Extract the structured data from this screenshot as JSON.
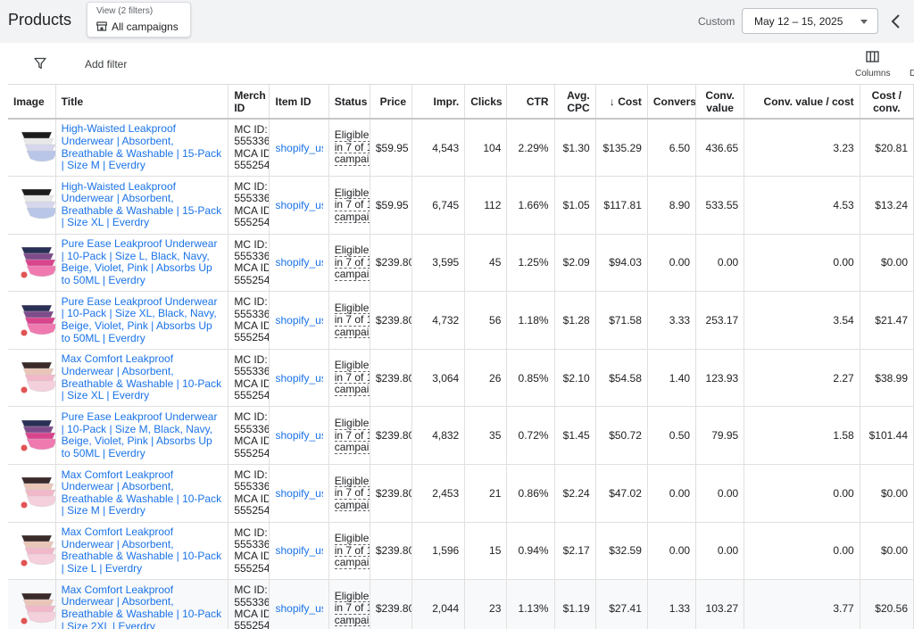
{
  "header": {
    "title": "Products",
    "view_label": "View (2 filters)",
    "view_value": "All campaigns",
    "custom_label": "Custom",
    "date_range": "May 12 – 15, 2025"
  },
  "toolbar": {
    "add_filter": "Add filter",
    "columns_label": "Columns",
    "truncated_label": "D"
  },
  "columns": {
    "image": "Image",
    "title": "Title",
    "merch_id": "Merch ID",
    "item_id": "Item ID",
    "status": "Status",
    "price": "Price",
    "impr": "Impr.",
    "clicks": "Clicks",
    "ctr": "CTR",
    "avg_cpc": "Avg. CPC",
    "cost": "Cost",
    "cost_sort_indicator": "↓",
    "conversions": "Convers",
    "conv_value": "Conv. value",
    "conv_value_cost": "Conv. value / cost",
    "cost_conv": "Cost / conv."
  },
  "icons": {
    "view": "store-icon",
    "filter": "filter-icon",
    "columns": "columns-icon",
    "back": "chevron-left-icon",
    "date_caret": "caret-down-icon"
  },
  "rows": [
    {
      "title": "High-Waisted Leakproof Underwear | Absorbent, Breathable & Washable | 15-Pack | Size M | Everdry",
      "merch": "MC ID: 555336 MCA ID 555254",
      "item_id": "shopify_us_",
      "status": "Eligible in 7 of 1 campai",
      "price": "$59.95",
      "impr": "4,543",
      "clicks": "104",
      "ctr": "2.29%",
      "cpc": "$1.30",
      "cost": "$135.29",
      "conv": "6.50",
      "conv_value": "436.65",
      "cvc": "3.23",
      "cost_conv": "$20.81"
    },
    {
      "title": "High-Waisted Leakproof Underwear | Absorbent, Breathable & Washable | 15-Pack | Size XL | Everdry",
      "merch": "MC ID: 555336 MCA ID 555254",
      "item_id": "shopify_us_",
      "status": "Eligible in 7 of 1 campai",
      "price": "$59.95",
      "impr": "6,745",
      "clicks": "112",
      "ctr": "1.66%",
      "cpc": "$1.05",
      "cost": "$117.81",
      "conv": "8.90",
      "conv_value": "533.55",
      "cvc": "4.53",
      "cost_conv": "$13.24"
    },
    {
      "title": "Pure Ease Leakproof Underwear | 10-Pack | Size L, Black, Navy, Beige, Violet, Pink | Absorbs Up to 50ML | Everdry",
      "merch": "MC ID: 555336 MCA ID 555254",
      "item_id": "shopify_us_",
      "status": "Eligible in 7 of 1 campai",
      "price": "$239.80",
      "impr": "3,595",
      "clicks": "45",
      "ctr": "1.25%",
      "cpc": "$2.09",
      "cost": "$94.03",
      "conv": "0.00",
      "conv_value": "0.00",
      "cvc": "0.00",
      "cost_conv": "$0.00"
    },
    {
      "title": "Pure Ease Leakproof Underwear | 10-Pack | Size XL, Black, Navy, Beige, Violet, Pink | Absorbs Up to 50ML | Everdry",
      "merch": "MC ID: 555336 MCA ID 555254",
      "item_id": "shopify_us_",
      "status": "Eligible in 7 of 1 campai",
      "price": "$239.80",
      "impr": "4,732",
      "clicks": "56",
      "ctr": "1.18%",
      "cpc": "$1.28",
      "cost": "$71.58",
      "conv": "3.33",
      "conv_value": "253.17",
      "cvc": "3.54",
      "cost_conv": "$21.47"
    },
    {
      "title": "Max Comfort Leakproof Underwear | Absorbent, Breathable & Washable | 10-Pack | Size XL | Everdry",
      "merch": "MC ID: 555336 MCA ID 555254",
      "item_id": "shopify_us_",
      "status": "Eligible in 7 of 1 campai",
      "price": "$239.80",
      "impr": "3,064",
      "clicks": "26",
      "ctr": "0.85%",
      "cpc": "$2.10",
      "cost": "$54.58",
      "conv": "1.40",
      "conv_value": "123.93",
      "cvc": "2.27",
      "cost_conv": "$38.99"
    },
    {
      "title": "Pure Ease Leakproof Underwear | 10-Pack | Size M, Black, Navy, Beige, Violet, Pink | Absorbs Up to 50ML | Everdry",
      "merch": "MC ID: 555336 MCA ID 555254",
      "item_id": "shopify_us_",
      "status": "Eligible in 7 of 1 campai",
      "price": "$239.80",
      "impr": "4,832",
      "clicks": "35",
      "ctr": "0.72%",
      "cpc": "$1.45",
      "cost": "$50.72",
      "conv": "0.50",
      "conv_value": "79.95",
      "cvc": "1.58",
      "cost_conv": "$101.44"
    },
    {
      "title": "Max Comfort Leakproof Underwear | Absorbent, Breathable & Washable | 10-Pack | Size M | Everdry",
      "merch": "MC ID: 555336 MCA ID 555254",
      "item_id": "shopify_us_",
      "status": "Eligible in 7 of 1 campai",
      "price": "$239.80",
      "impr": "2,453",
      "clicks": "21",
      "ctr": "0.86%",
      "cpc": "$2.24",
      "cost": "$47.02",
      "conv": "0.00",
      "conv_value": "0.00",
      "cvc": "0.00",
      "cost_conv": "$0.00"
    },
    {
      "title": "Max Comfort Leakproof Underwear | Absorbent, Breathable & Washable | 10-Pack | Size L | Everdry",
      "merch": "MC ID: 555336 MCA ID 555254",
      "item_id": "shopify_us_",
      "status": "Eligible in 7 of 1 campai",
      "price": "$239.80",
      "impr": "1,596",
      "clicks": "15",
      "ctr": "0.94%",
      "cpc": "$2.17",
      "cost": "$32.59",
      "conv": "0.00",
      "conv_value": "0.00",
      "cvc": "0.00",
      "cost_conv": "$0.00"
    },
    {
      "title": "Max Comfort Leakproof Underwear | Absorbent, Breathable & Washable | 10-Pack | Size 2XL | Everdry",
      "merch": "MC ID: 555336 MCA ID 555254",
      "item_id": "shopify_us_",
      "status": "Eligible in 7 of 1 campai",
      "price": "$239.80",
      "impr": "2,044",
      "clicks": "23",
      "ctr": "1.13%",
      "cpc": "$1.19",
      "cost": "$27.41",
      "conv": "1.33",
      "conv_value": "103.27",
      "cvc": "3.77",
      "cost_conv": "$20.56"
    }
  ]
}
